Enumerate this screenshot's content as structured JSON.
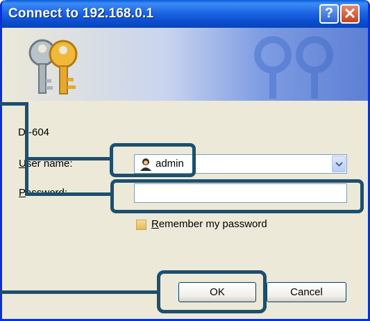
{
  "window": {
    "title": "Connect to 192.168.0.1",
    "help_icon": "?",
    "close_icon": "✕"
  },
  "form": {
    "device_label": "DI-604",
    "username_label_first": "U",
    "username_label_rest": "ser name:",
    "username_value": "admin",
    "password_label_first": "P",
    "password_label_rest": "assword:",
    "password_value": "",
    "remember_label_first": "R",
    "remember_label_rest": "emember my password"
  },
  "buttons": {
    "ok": "OK",
    "cancel": "Cancel"
  },
  "colors": {
    "titlebar": "#0b4fd0",
    "callout": "#1d4f6e",
    "dialog_bg": "#ece9d8"
  }
}
